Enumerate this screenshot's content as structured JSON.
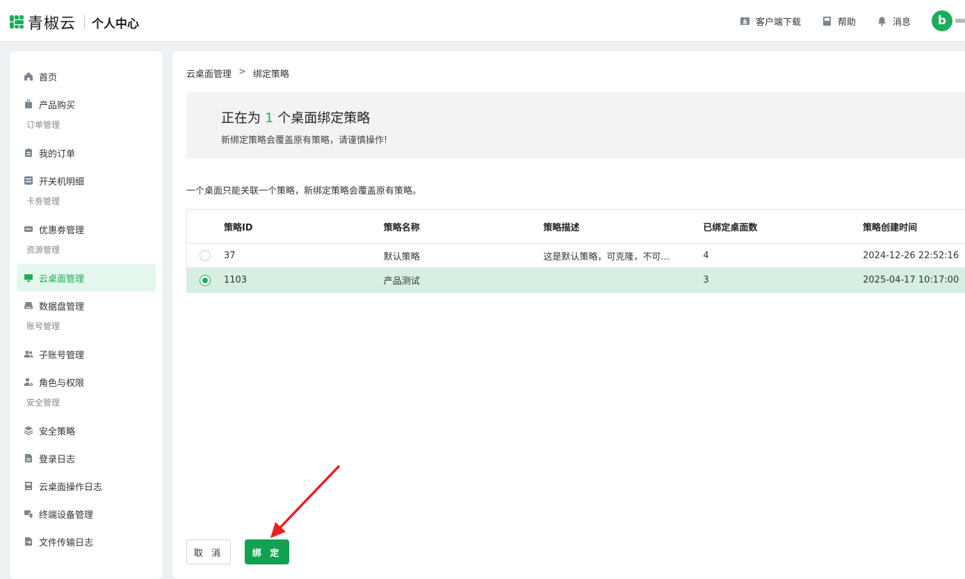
{
  "header": {
    "logo_text": "青椒云",
    "subtitle": "个人中心",
    "actions": [
      {
        "label": "客户端下载",
        "icon": "download-icon"
      },
      {
        "label": "帮助",
        "icon": "book-icon"
      },
      {
        "label": "消息",
        "icon": "bell-icon"
      }
    ],
    "avatar_letter": "b"
  },
  "sidebar": {
    "items": [
      {
        "type": "item",
        "label": "首页",
        "icon": "home-icon"
      },
      {
        "type": "item",
        "label": "产品购买",
        "icon": "shopping-bag-icon"
      },
      {
        "type": "group",
        "label": "订单管理"
      },
      {
        "type": "item",
        "label": "我的订单",
        "icon": "clipboard-icon"
      },
      {
        "type": "item",
        "label": "开关机明细",
        "icon": "checklist-icon"
      },
      {
        "type": "group",
        "label": "卡劵管理"
      },
      {
        "type": "item",
        "label": "优惠劵管理",
        "icon": "ticket-icon"
      },
      {
        "type": "group",
        "label": "资源管理"
      },
      {
        "type": "item",
        "label": "云桌面管理",
        "icon": "monitor-icon",
        "active": true
      },
      {
        "type": "item",
        "label": "数据盘管理",
        "icon": "disk-icon"
      },
      {
        "type": "group",
        "label": "账号管理"
      },
      {
        "type": "item",
        "label": "子账号管理",
        "icon": "users-icon"
      },
      {
        "type": "item",
        "label": "角色与权限",
        "icon": "user-gear-icon"
      },
      {
        "type": "group",
        "label": "安全管理"
      },
      {
        "type": "item",
        "label": "安全策略",
        "icon": "layers-icon"
      },
      {
        "type": "item",
        "label": "登录日志",
        "icon": "document-icon"
      },
      {
        "type": "item",
        "label": "云桌面操作日志",
        "icon": "log-icon"
      },
      {
        "type": "item",
        "label": "终端设备管理",
        "icon": "devices-icon"
      },
      {
        "type": "item",
        "label": "文件传输日志",
        "icon": "file-transfer-icon"
      }
    ]
  },
  "breadcrumb": {
    "parent": "云桌面管理",
    "separator": ">",
    "current": "绑定策略"
  },
  "banner": {
    "title_prefix": "正在为",
    "count": "1",
    "title_suffix": "个桌面绑定策略",
    "note": "新绑定策略会覆盖原有策略，请谨慎操作!"
  },
  "tip": "一个桌面只能关联一个策略，新绑定策略会覆盖原有策略。",
  "table": {
    "columns": [
      "策略ID",
      "策略名称",
      "策略描述",
      "已绑定桌面数",
      "策略创建时间"
    ],
    "rows": [
      {
        "id": "37",
        "name": "默认策略",
        "desc": "这是默认策略，可克隆，不可...",
        "count": "4",
        "created": "2024-12-26 22:52:16",
        "selected": false
      },
      {
        "id": "1103",
        "name": "产品测试",
        "desc": "",
        "count": "3",
        "created": "2025-04-17 10:17:00",
        "selected": true
      }
    ]
  },
  "buttons": {
    "cancel": "取 消",
    "bind": "绑 定"
  },
  "colors": {
    "accent": "#1aad5a",
    "button": "#12a150",
    "selected_row": "#d6efe0",
    "annotation_arrow": "#e8201e"
  }
}
